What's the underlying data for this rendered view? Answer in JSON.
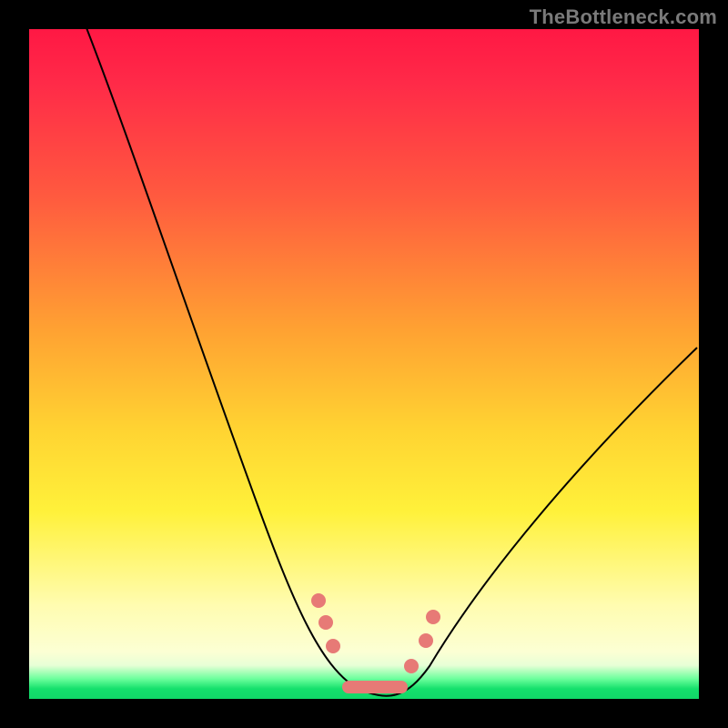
{
  "watermark": "TheBottleneck.com",
  "colors": {
    "frame": "#000000",
    "gradient_top": "#ff1844",
    "gradient_mid": "#ffd432",
    "gradient_bottom": "#11d868",
    "curve": "#000000",
    "marker": "#e77a76"
  },
  "chart_data": {
    "type": "line",
    "title": "",
    "xlabel": "",
    "ylabel": "",
    "xlim": [
      0,
      100
    ],
    "ylim": [
      0,
      100
    ],
    "series": [
      {
        "name": "bottleneck-curve",
        "x": [
          10,
          15,
          20,
          25,
          30,
          35,
          40,
          45,
          47,
          49,
          51,
          53,
          55,
          58,
          62,
          68,
          75,
          82,
          90,
          98
        ],
        "y": [
          100,
          88,
          77,
          65,
          54,
          42,
          30,
          14,
          8,
          3,
          1,
          1,
          3,
          7,
          14,
          24,
          35,
          45,
          55,
          64
        ]
      }
    ],
    "markers": [
      {
        "shape": "circle",
        "x": 44,
        "y": 15
      },
      {
        "shape": "circle",
        "x": 45,
        "y": 10
      },
      {
        "shape": "circle",
        "x": 46,
        "y": 6
      },
      {
        "shape": "bar",
        "x0": 48,
        "x1": 55,
        "y": 1
      },
      {
        "shape": "circle",
        "x": 56,
        "y": 5
      },
      {
        "shape": "circle",
        "x": 58,
        "y": 9
      },
      {
        "shape": "circle",
        "x": 59,
        "y": 13
      }
    ],
    "annotations": []
  }
}
